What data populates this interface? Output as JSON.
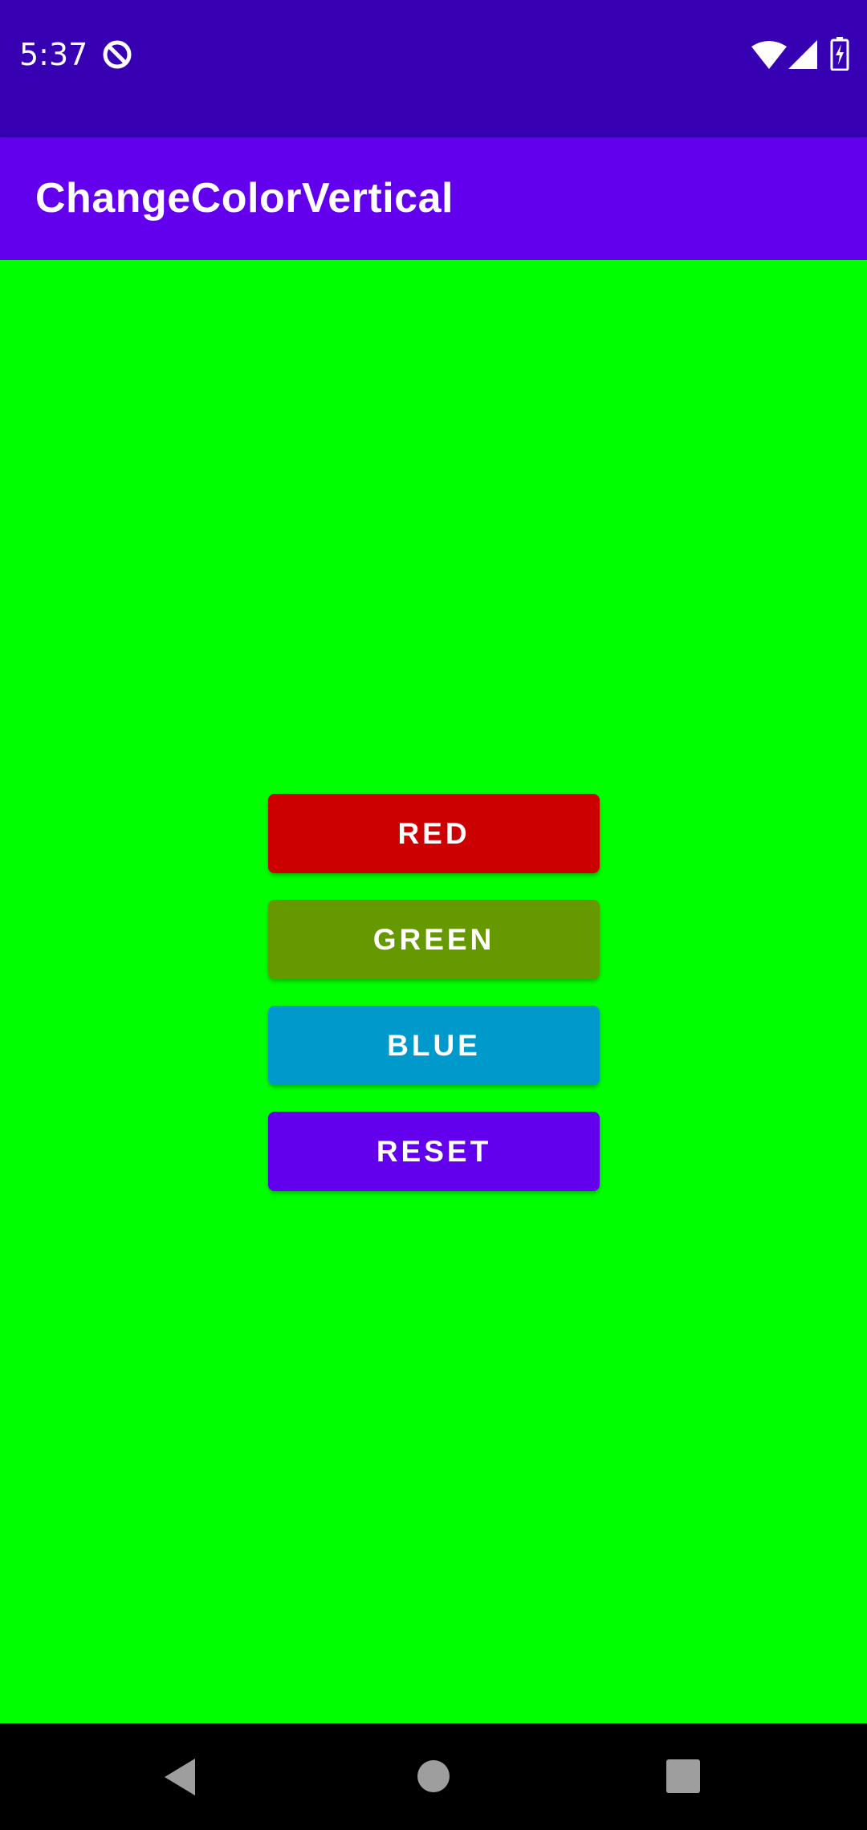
{
  "status_bar": {
    "time": "5:37",
    "icons": [
      "data-saver-icon",
      "wifi-icon",
      "cellular-signal-icon",
      "battery-charging-icon"
    ]
  },
  "app_bar": {
    "title": "ChangeColorVertical"
  },
  "content": {
    "background_color": "#00ff00"
  },
  "buttons": {
    "red": {
      "label": "RED",
      "color": "#cc0000"
    },
    "green": {
      "label": "GREEN",
      "color": "#669900"
    },
    "blue": {
      "label": "BLUE",
      "color": "#0099cc"
    },
    "reset": {
      "label": "RESET",
      "color": "#6200ee"
    }
  },
  "navigation_bar": {
    "icons": [
      "back-icon",
      "home-icon",
      "recents-icon"
    ]
  },
  "colors": {
    "status_bar": "#3700b3",
    "app_bar": "#6200ee"
  }
}
